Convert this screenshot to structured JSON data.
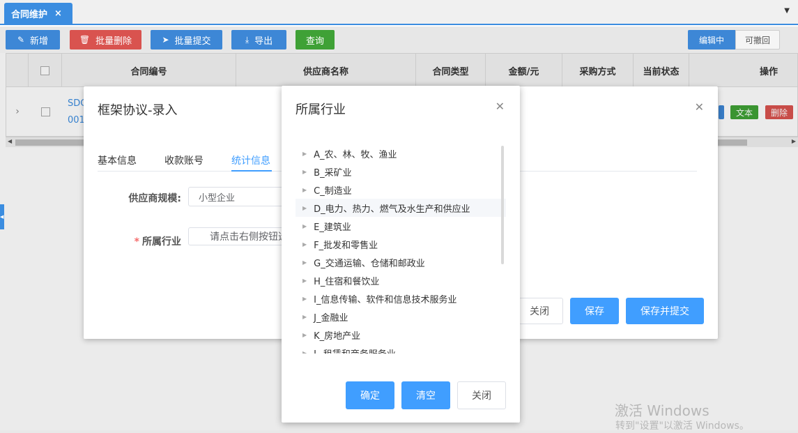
{
  "tab": {
    "label": "合同维护",
    "close": "×"
  },
  "toolbar": {
    "add": "新增",
    "batch_delete": "批量删除",
    "batch_submit": "批量提交",
    "export": "导出",
    "query": "查询",
    "mode_editing": "编辑中",
    "mode_revocable": "可撤回"
  },
  "grid": {
    "columns": [
      "合同编号",
      "供应商名称",
      "合同类型",
      "金额/元",
      "采购方式",
      "当前状态",
      "操作"
    ],
    "row": {
      "contract_no_partial_1": "SDC",
      "contract_no_partial_2": "001",
      "action_text": "文本",
      "action_delete": "删除"
    }
  },
  "framework_dialog": {
    "title": "框架协议-录入",
    "tabs": [
      "基本信息",
      "收款账号",
      "统计信息"
    ],
    "active_tab": "统计信息",
    "supplier_scale_label": "供应商规模:",
    "supplier_scale_value": "小型企业",
    "industry_label": "所属行业",
    "industry_placeholder": "请点击右侧按钮选",
    "close_button": "关闭",
    "save_button": "保存",
    "save_submit_button": "保存并提交"
  },
  "industry_dialog": {
    "title": "所属行业",
    "items": [
      "A_农、林、牧、渔业",
      "B_采矿业",
      "C_制造业",
      "D_电力、热力、燃气及水生产和供应业",
      "E_建筑业",
      "F_批发和零售业",
      "G_交通运输、仓储和邮政业",
      "H_住宿和餐饮业",
      "I_信息传输、软件和信息技术服务业",
      "J_金融业",
      "K_房地产业",
      "L_租赁和商务服务业"
    ],
    "highlighted_index": 3,
    "confirm_button": "确定",
    "clear_button": "清空",
    "close_button": "关闭"
  },
  "watermark": {
    "line1": "激活 Windows",
    "line2": "转到\"设置\"以激活 Windows。"
  }
}
